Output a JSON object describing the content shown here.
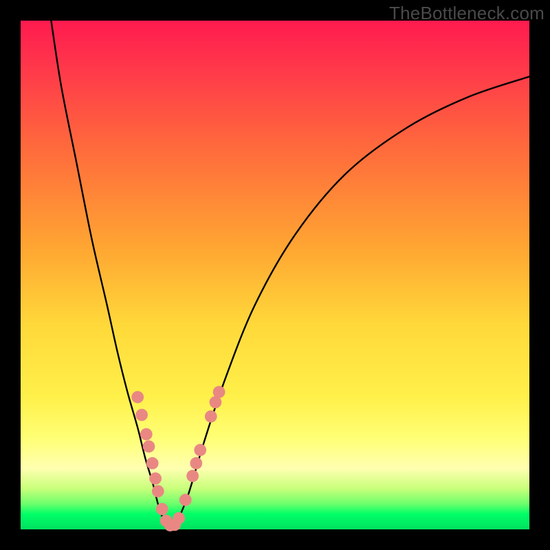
{
  "watermark": "TheBottleneck.com",
  "colors": {
    "frame": "#000000",
    "curve_stroke": "#000000",
    "marker_fill": "#e98883",
    "gradient_top": "#ff1a4f",
    "gradient_bottom": "#00e060"
  },
  "chart_data": {
    "type": "line",
    "title": "",
    "xlabel": "",
    "ylabel": "",
    "xlim": [
      0,
      100
    ],
    "ylim": [
      0,
      100
    ],
    "note": "Axes have no tick labels in the source image; values are relative percentages read from position along the plot area.",
    "series": [
      {
        "name": "left-branch",
        "x": [
          6,
          8,
          11,
          14,
          17,
          19,
          21,
          23,
          24.5,
          26,
          27,
          28
        ],
        "y": [
          100,
          87,
          72,
          57,
          44,
          35,
          27,
          20,
          14,
          9,
          5,
          2
        ]
      },
      {
        "name": "trough",
        "x": [
          28,
          29,
          30,
          31
        ],
        "y": [
          2,
          0.7,
          0.7,
          2
        ]
      },
      {
        "name": "right-branch",
        "x": [
          31,
          33,
          36,
          40,
          46,
          54,
          64,
          76,
          88,
          100
        ],
        "y": [
          2,
          7,
          17,
          29,
          44,
          58,
          70,
          79,
          85,
          89
        ]
      }
    ],
    "markers": [
      {
        "x": 23.0,
        "y": 26.0
      },
      {
        "x": 23.8,
        "y": 22.5
      },
      {
        "x": 24.7,
        "y": 18.7
      },
      {
        "x": 25.2,
        "y": 16.3
      },
      {
        "x": 25.9,
        "y": 13.0
      },
      {
        "x": 26.5,
        "y": 10.0
      },
      {
        "x": 27.0,
        "y": 7.5
      },
      {
        "x": 27.8,
        "y": 4.0
      },
      {
        "x": 28.6,
        "y": 1.7
      },
      {
        "x": 29.4,
        "y": 0.8
      },
      {
        "x": 30.3,
        "y": 0.9
      },
      {
        "x": 31.1,
        "y": 2.2
      },
      {
        "x": 32.4,
        "y": 5.8
      },
      {
        "x": 33.8,
        "y": 10.5
      },
      {
        "x": 34.5,
        "y": 13.0
      },
      {
        "x": 35.3,
        "y": 15.6
      },
      {
        "x": 37.4,
        "y": 22.2
      },
      {
        "x": 38.3,
        "y": 25.0
      },
      {
        "x": 39.0,
        "y": 27.0
      }
    ],
    "marker_radius_pct": 1.2
  }
}
